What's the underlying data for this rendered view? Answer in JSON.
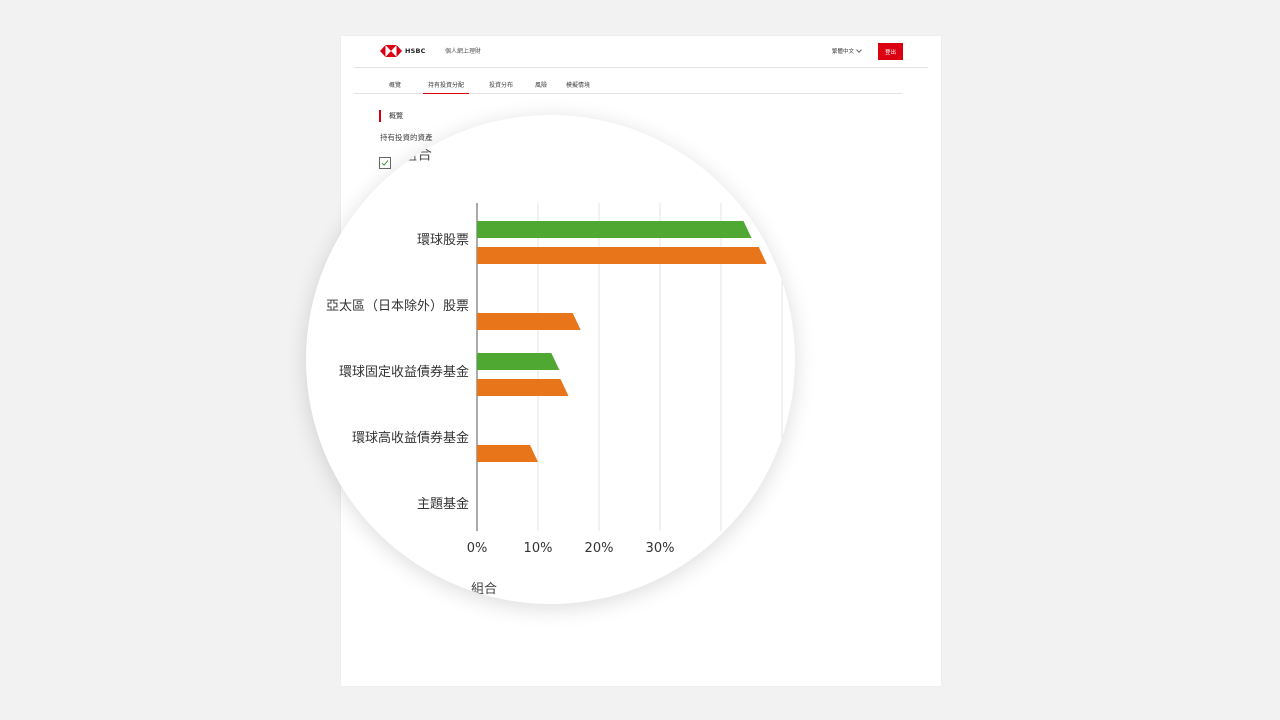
{
  "header": {
    "logo_text": "HSBC",
    "app_name": "個人網上理財",
    "language": "繁體中文",
    "logout_label": "登出"
  },
  "tabs": [
    {
      "label": "概覽",
      "active": false
    },
    {
      "label": "持有投資分配",
      "active": true
    },
    {
      "label": "投資分布",
      "active": false
    },
    {
      "label": "風險",
      "active": false
    },
    {
      "label": "模擬情境",
      "active": false
    }
  ],
  "section": {
    "title": "概覽",
    "description": "持有投資的資產"
  },
  "magnifier": {
    "legend_top_text": "組合",
    "check_text": "",
    "legend_bottom_text": "組合"
  },
  "colors": {
    "accent": "#db0011",
    "series_green": "#4ea832",
    "series_orange": "#e8751a"
  },
  "chart_data": {
    "type": "bar",
    "orientation": "horizontal",
    "categories": [
      "環球股票",
      "亞太區（日本除外）股票",
      "環球固定收益債券基金",
      "環球高收益債券基金",
      "主題基金"
    ],
    "series": [
      {
        "color": "#4ea832",
        "values": [
          45,
          0,
          13.5,
          0,
          0
        ]
      },
      {
        "color": "#e8751a",
        "values": [
          47.5,
          17,
          15,
          10,
          0
        ]
      }
    ],
    "x_ticks": [
      "0%",
      "10%",
      "20%",
      "30%"
    ],
    "xlim": [
      0,
      50
    ],
    "grid": true
  }
}
